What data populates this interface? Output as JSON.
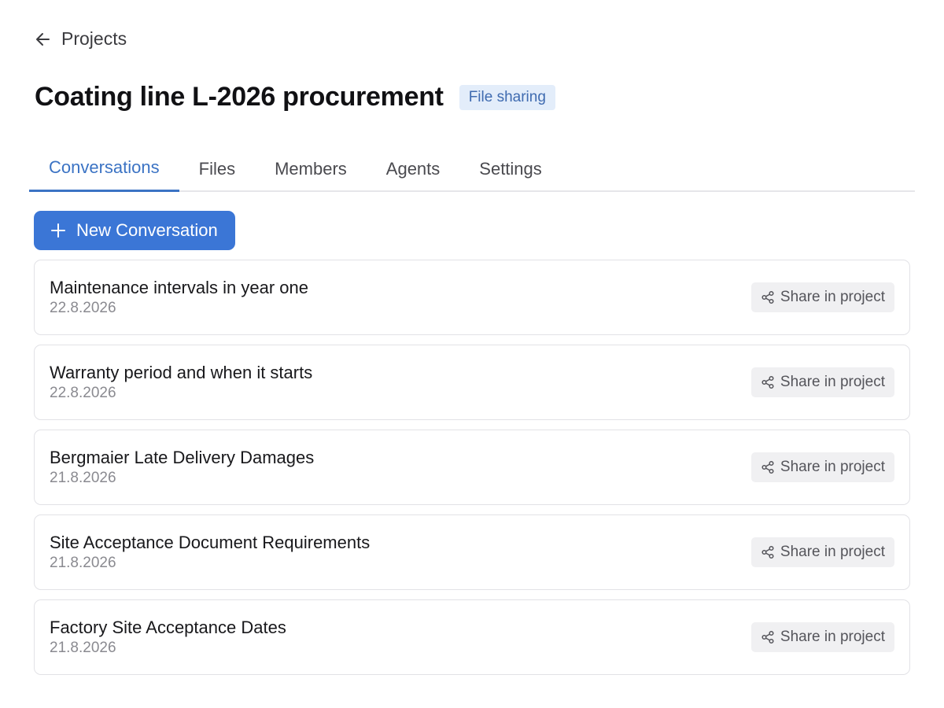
{
  "navigation": {
    "back_label": "Projects",
    "back_icon": "arrow-left-icon"
  },
  "header": {
    "title": "Coating line L-2026 procurement",
    "badge": "File sharing"
  },
  "tabs": [
    {
      "label": "Conversations",
      "active": true
    },
    {
      "label": "Files",
      "active": false
    },
    {
      "label": "Members",
      "active": false
    },
    {
      "label": "Agents",
      "active": false
    },
    {
      "label": "Settings",
      "active": false
    }
  ],
  "actions": {
    "new_conversation_label": "New Conversation",
    "new_conversation_icon": "plus-icon"
  },
  "conversations": [
    {
      "title": "Maintenance intervals in year one",
      "date": "22.8.2026",
      "share_label": "Share in project"
    },
    {
      "title": "Warranty period and when it starts",
      "date": "22.8.2026",
      "share_label": "Share in project"
    },
    {
      "title": "Bergmaier Late Delivery Damages",
      "date": "21.8.2026",
      "share_label": "Share in project"
    },
    {
      "title": "Site Acceptance Document Requirements",
      "date": "21.8.2026",
      "share_label": "Share in project"
    },
    {
      "title": "Factory Site Acceptance Dates",
      "date": "21.8.2026",
      "share_label": "Share in project"
    }
  ],
  "colors": {
    "accent": "#3b76d6",
    "active_tab": "#3b73c4",
    "badge_bg": "#e3edfa",
    "badge_text": "#3f6bb0"
  }
}
